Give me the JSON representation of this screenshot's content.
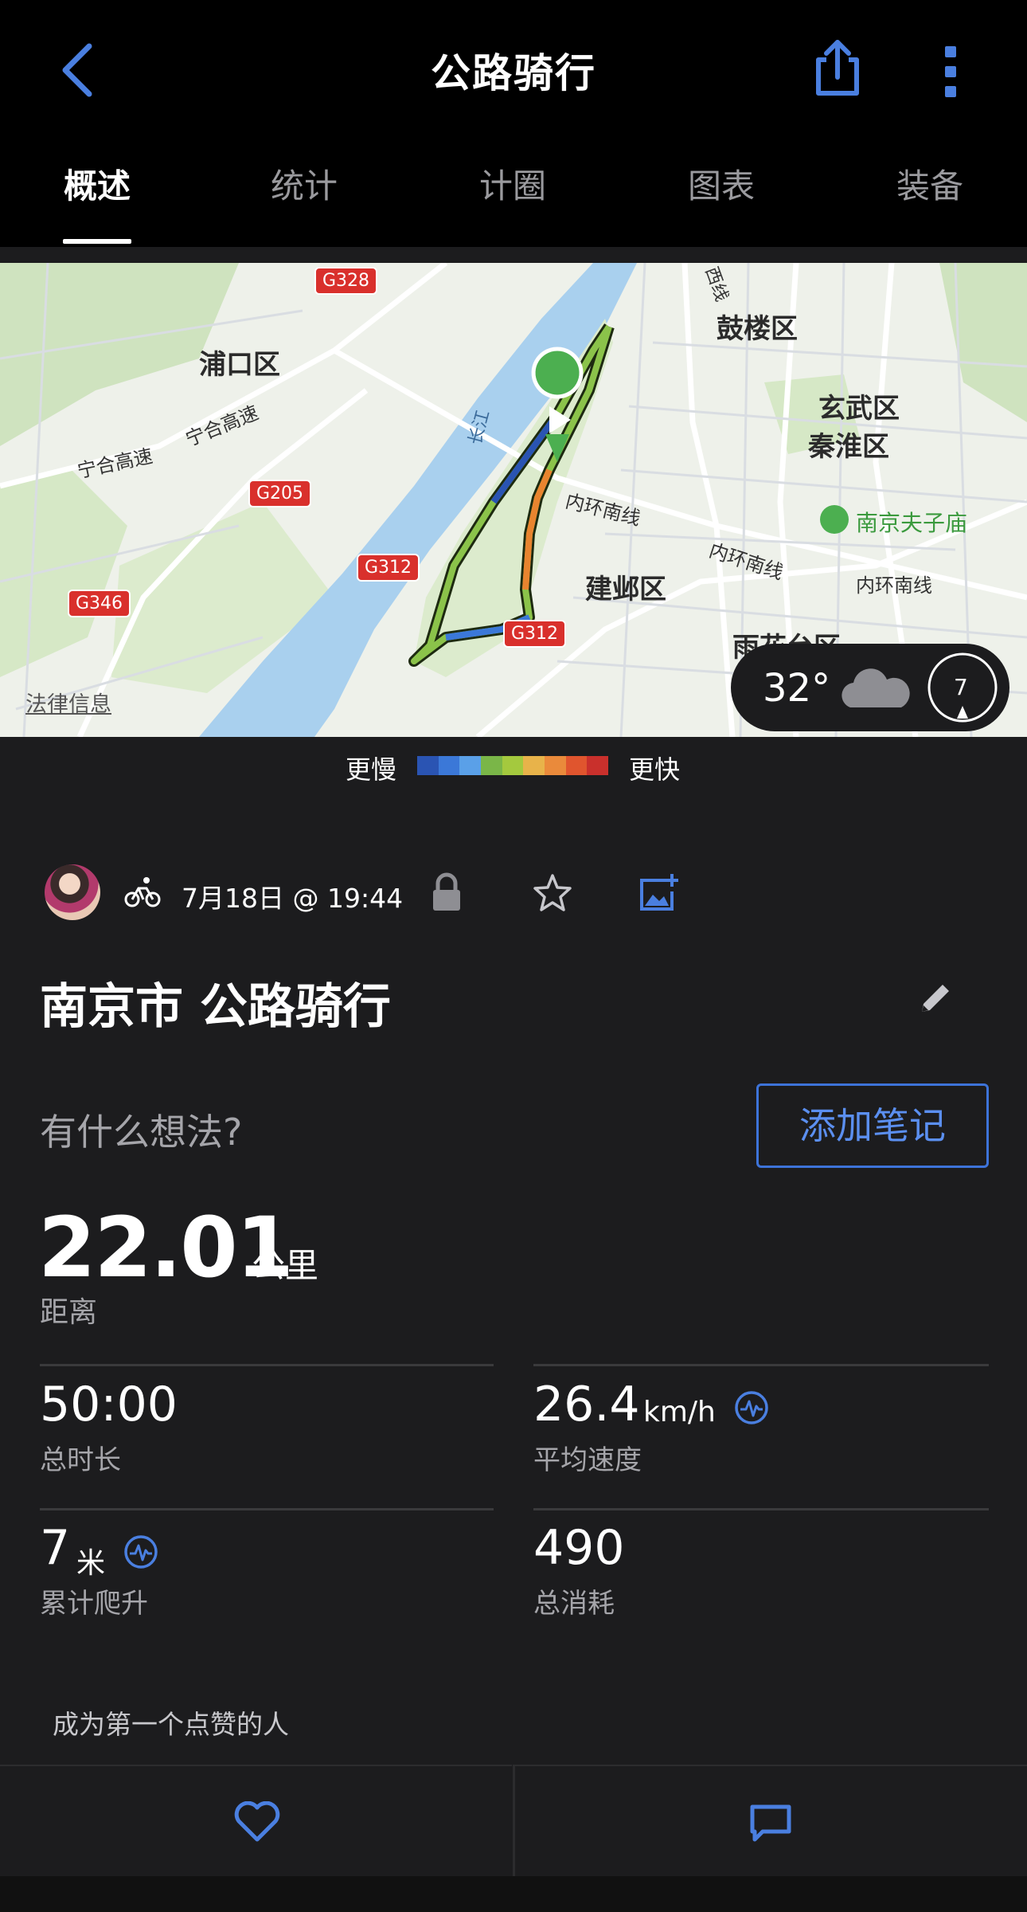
{
  "header": {
    "title": "公路骑行"
  },
  "tabs": [
    {
      "label": "概述",
      "active": true
    },
    {
      "label": "统计",
      "active": false
    },
    {
      "label": "计圈",
      "active": false
    },
    {
      "label": "图表",
      "active": false
    },
    {
      "label": "装备",
      "active": false
    }
  ],
  "map": {
    "districts": [
      "浦口区",
      "鼓楼区",
      "玄武区",
      "秦淮区",
      "建邺区",
      "雨花台区"
    ],
    "roads": [
      "宁合高速",
      "宁合高速",
      "内环南线",
      "内环南线",
      "内环南线",
      "长江",
      "西线"
    ],
    "route_badges": [
      "G328",
      "G205",
      "G312",
      "G346",
      "G312"
    ],
    "poi": "南京夫子庙",
    "legal": "法律信息",
    "weather": {
      "temperature": "32°",
      "wind": "7"
    }
  },
  "legend": {
    "slower": "更慢",
    "faster": "更快",
    "colors": [
      "#2a54b3",
      "#3b78d8",
      "#5aa0e8",
      "#7ab648",
      "#a4c93e",
      "#e8b34a",
      "#ea8a3b",
      "#e0552e",
      "#c9302c"
    ]
  },
  "activity": {
    "datetime": "7月18日 @ 19:44",
    "title": "南京市 公路骑行",
    "thoughts_prompt": "有什么想法?",
    "add_note_label": "添加笔记"
  },
  "distance": {
    "value": "22.01",
    "unit": "公里",
    "label": "距离"
  },
  "stats": {
    "duration": {
      "value": "50:00",
      "label": "总时长"
    },
    "avg_speed": {
      "value": "26.4",
      "unit": "km/h",
      "label": "平均速度"
    },
    "elevation": {
      "value": "7",
      "unit": "米",
      "label": "累计爬升"
    },
    "calories": {
      "value": "490",
      "label": "总消耗"
    }
  },
  "social": {
    "likes_note": "成为第一个点赞的人"
  },
  "colors": {
    "accent": "#5b8ff0",
    "background": "#1c1c1e",
    "topbar": "#000000"
  }
}
